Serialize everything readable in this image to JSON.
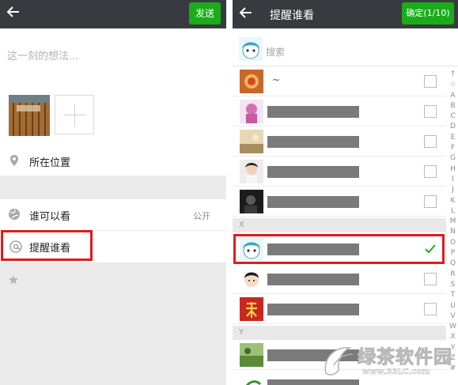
{
  "left": {
    "send_label": "发送",
    "compose_placeholder": "这一刻的想法...",
    "location_label": "所在位置",
    "who_can_see_label": "谁可以看",
    "who_can_see_value": "公开",
    "remind_label": "提醒谁看"
  },
  "right": {
    "title": "提醒谁看",
    "confirm_label": "确定(1/10)",
    "search_placeholder": "搜索",
    "contacts": [
      {
        "name": "~",
        "checked": false
      },
      {
        "name": "",
        "checked": false
      },
      {
        "name": "",
        "checked": false
      },
      {
        "name": "",
        "checked": false
      },
      {
        "name": "",
        "checked": false
      }
    ],
    "section_x": "X",
    "contacts_x": [
      {
        "name": "",
        "checked": true
      },
      {
        "name": "",
        "checked": false
      },
      {
        "name": "",
        "checked": false
      }
    ],
    "section_y": "Y",
    "index_letters": [
      "↑",
      "☆",
      "A",
      "B",
      "C",
      "D",
      "E",
      "F",
      "G",
      "H",
      "I",
      "J",
      "K",
      "L",
      "M",
      "N",
      "O",
      "P",
      "Q",
      "R",
      "S",
      "T",
      "U",
      "V",
      "W",
      "X",
      "Y",
      "Z",
      "#"
    ]
  },
  "watermark": {
    "brand": "绿茶软件园",
    "url": "www.33LC.com"
  },
  "colors": {
    "topbar": "#393a3f",
    "accent_green": "#1aad19",
    "highlight_red": "#e01b1b"
  }
}
